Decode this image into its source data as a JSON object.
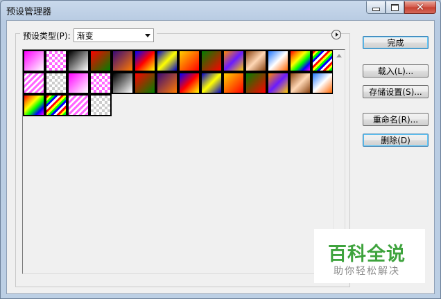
{
  "window": {
    "title": "预设管理器",
    "controls": {
      "minimize": "minimize-icon",
      "maximize": "maximize-icon",
      "close": "✕"
    }
  },
  "preset": {
    "type_label": "预设类型(P):",
    "type_value": "渐变"
  },
  "buttons": {
    "done": "完成",
    "load": "载入(L)...",
    "save_set": "存储设置(S)...",
    "rename": "重命名(R)...",
    "delete": "删除(D)"
  },
  "swatches": [
    {
      "bg": "linear-gradient(135deg,#ff00ff,#ffffff)"
    },
    {
      "bg": "repeating-conic-gradient(#ff66ff 0 25%,#ffffff 0 50%) 0 0/8px 8px"
    },
    {
      "bg": "linear-gradient(135deg,#000000,#ffffff)"
    },
    {
      "bg": "linear-gradient(135deg,#ff0000,#008000)"
    },
    {
      "bg": "linear-gradient(135deg,#3a0a78,#ff7a00)"
    },
    {
      "bg": "linear-gradient(135deg,#0000ff,#ff0000,#ffff00)"
    },
    {
      "bg": "linear-gradient(135deg,#0000cc,#ffff00,#0000cc)"
    },
    {
      "bg": "linear-gradient(135deg,#ffd000,#ff0000)"
    },
    {
      "bg": "linear-gradient(135deg,#008000,#ff0000)"
    },
    {
      "bg": "linear-gradient(135deg,#ff8800,#6a1bff,#ffcc00)"
    },
    {
      "bg": "linear-gradient(135deg,#8b4513,#ffd7b5,#8b4513)"
    },
    {
      "bg": "linear-gradient(135deg,#2277ff,#ffffff,#ff6600)"
    },
    {
      "bg": "linear-gradient(135deg,#ff0000,#ff8800,#ffff00,#00ff00,#0000ff,#ff00ff)"
    },
    {
      "bg": "repeating-linear-gradient(135deg,#ff0000 0 3px,#ffff00 3px 6px,#00ff00 6px 9px,#0000ff 9px 12px,#ffffff 12px 15px)"
    },
    {
      "bg": "repeating-linear-gradient(135deg,#ff66ff 0 3px,#ffffff 3px 6px)"
    },
    {
      "bg": "repeating-conic-gradient(#cccccc 0 25%,#ffffff 0 50%) 0 0/8px 8px"
    },
    {
      "bg": "linear-gradient(135deg,#ff00ff,#ffffff)"
    },
    {
      "bg": "repeating-conic-gradient(#ff66ff 0 25%,#ffffff 0 50%) 0 0/8px 8px"
    },
    {
      "bg": "linear-gradient(135deg,#000000,#ffffff)"
    },
    {
      "bg": "linear-gradient(135deg,#ff0000,#008000)"
    },
    {
      "bg": "linear-gradient(135deg,#3a0a78,#ff7a00)"
    },
    {
      "bg": "linear-gradient(135deg,#0000ff,#ff0000,#ffff00)"
    },
    {
      "bg": "linear-gradient(135deg,#0000cc,#ffff00,#0000cc)"
    },
    {
      "bg": "linear-gradient(135deg,#ffd000,#ff0000)"
    },
    {
      "bg": "linear-gradient(135deg,#008000,#ff0000)"
    },
    {
      "bg": "linear-gradient(135deg,#ff8800,#6a1bff,#ffcc00)"
    },
    {
      "bg": "linear-gradient(135deg,#8b4513,#ffd7b5,#8b4513)"
    },
    {
      "bg": "linear-gradient(135deg,#2277ff,#ffffff,#ff6600)"
    },
    {
      "bg": "linear-gradient(135deg,#ff0000,#ff8800,#ffff00,#00ff00,#0000ff,#ff00ff)"
    },
    {
      "bg": "repeating-linear-gradient(135deg,#ff0000 0 3px,#ffff00 3px 6px,#00ff00 6px 9px,#0000ff 9px 12px,#ffffff 12px 15px)"
    },
    {
      "bg": "repeating-linear-gradient(135deg,#ff66ff 0 3px,#ffffff 3px 6px)"
    },
    {
      "bg": "repeating-conic-gradient(#cccccc 0 25%,#ffffff 0 50%) 0 0/8px 8px"
    }
  ],
  "watermark": {
    "main": "百科全说",
    "sub": "助你轻松解决"
  }
}
